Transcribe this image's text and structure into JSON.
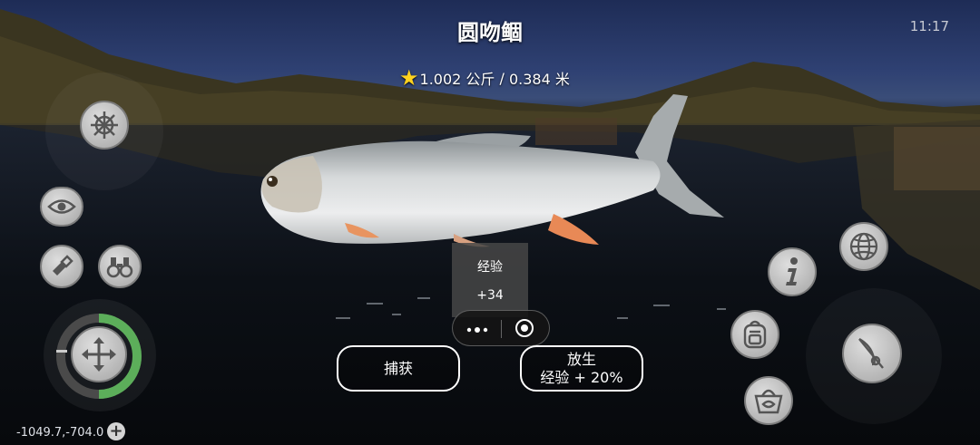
{
  "fish": {
    "name": "圆吻鲴",
    "weight": "1.002 公斤",
    "length": "0.384 米"
  },
  "clock": "11:17",
  "xp_popup": {
    "label": "经验",
    "value": "+34"
  },
  "buttons": {
    "catch": "捕获",
    "release_title": "放生",
    "release_bonus": "经验 + 20%"
  },
  "coordinates": "-1049.7,-704.0",
  "coord_add": "+",
  "icons": {
    "top_left": "ship-wheel-icon",
    "view": "eye-icon",
    "flashlight": "flashlight-icon",
    "binoculars": "binoculars-icon",
    "move": "move-arrows-icon",
    "info": "info-icon",
    "map": "globe-icon",
    "inventory": "backpack-icon",
    "cast": "fishing-rod-icon",
    "keepnet": "fish-basket-icon"
  },
  "colors": {
    "stamina_bar": "#5cae5a",
    "star": "#ffd21f"
  }
}
